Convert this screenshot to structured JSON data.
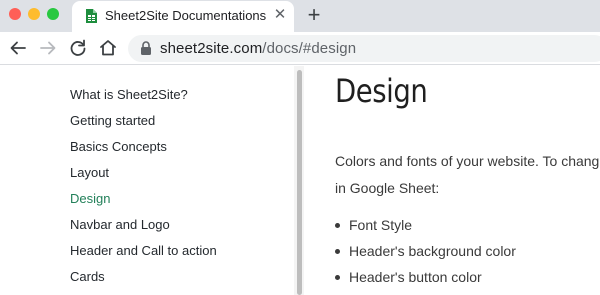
{
  "browser": {
    "tab": {
      "title": "Sheet2Site Documentations",
      "close_glyph": "✕"
    },
    "new_tab_glyph": "+",
    "address": {
      "domain": "sheet2site.com",
      "path": "/docs/#design"
    },
    "colors": {
      "tabstrip": "#dee1e6",
      "favicon": "#1e8e3e"
    }
  },
  "sidebar": {
    "items": [
      {
        "label": "What is Sheet2Site?"
      },
      {
        "label": "Getting started"
      },
      {
        "label": "Basics Concepts"
      },
      {
        "label": "Layout"
      },
      {
        "label": "Design",
        "active": true
      },
      {
        "label": "Navbar and Logo"
      },
      {
        "label": "Header and Call to action"
      },
      {
        "label": "Cards"
      }
    ],
    "active_color": "#23805a"
  },
  "main": {
    "heading": "Design",
    "intro_line1": "Colors and fonts of your website. To chang",
    "intro_line2": "in Google Sheet:",
    "bullets": [
      {
        "text": "Font Style"
      },
      {
        "text": "Header's background color"
      },
      {
        "text": "Header's button color"
      }
    ]
  }
}
